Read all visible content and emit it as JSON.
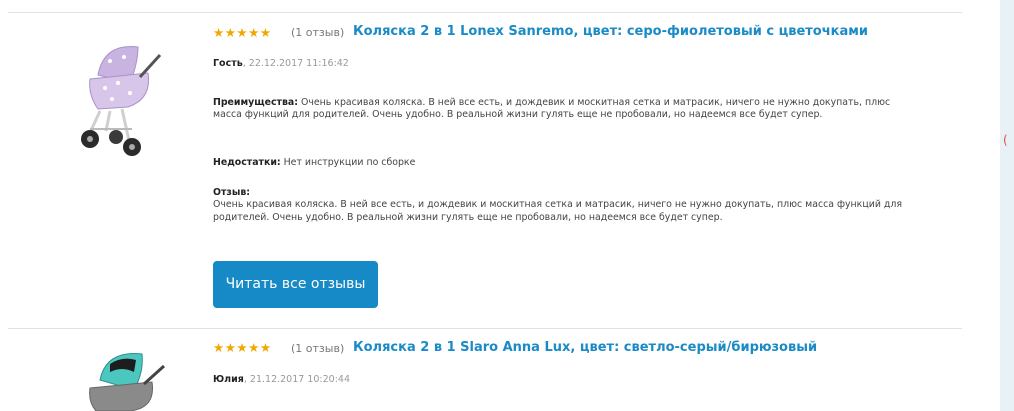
{
  "reviews": [
    {
      "rating_stars": "★★★★★",
      "count": "(1 отзыв)",
      "title": "Коляска 2 в 1 Lonex Sanremo, цвет: серо-фиолетовый с цветочками",
      "author": "Гость",
      "date": ", 22.12.2017 11:16:42",
      "pros_label": "Преимущества:",
      "pros": " Очень красивая коляска. В ней все есть, и дождевик и москитная сетка и матрасик, ничего не нужно докупать, плюс масса функций для родителей. Очень удобно. В реальной жизни гулять еще не пробовали, но надеемся все будет супер.",
      "cons_label": "Недостатки:",
      "cons": " Нет инструкции по сборке",
      "review_label": "Отзыв:",
      "review": "Очень красивая коляска. В ней все есть, и дождевик и москитная сетка и матрасик, ничего не нужно докупать, плюс масса функций для родителей. Очень удобно. В реальной жизни гулять еще не пробовали, но надеемся все будет супер."
    },
    {
      "rating_stars": "★★★★★",
      "count": "(1 отзыв)",
      "title": "Коляска 2 в 1 Slaro Anna Lux, цвет: светло-серый/бирюзовый",
      "author": "Юлия",
      "date": ", 21.12.2017 10:20:44"
    }
  ],
  "read_all_button": "Читать все отзывы",
  "colors": {
    "accent": "#1a8bc6",
    "button": "#1689c7",
    "stars": "#f0a800"
  }
}
